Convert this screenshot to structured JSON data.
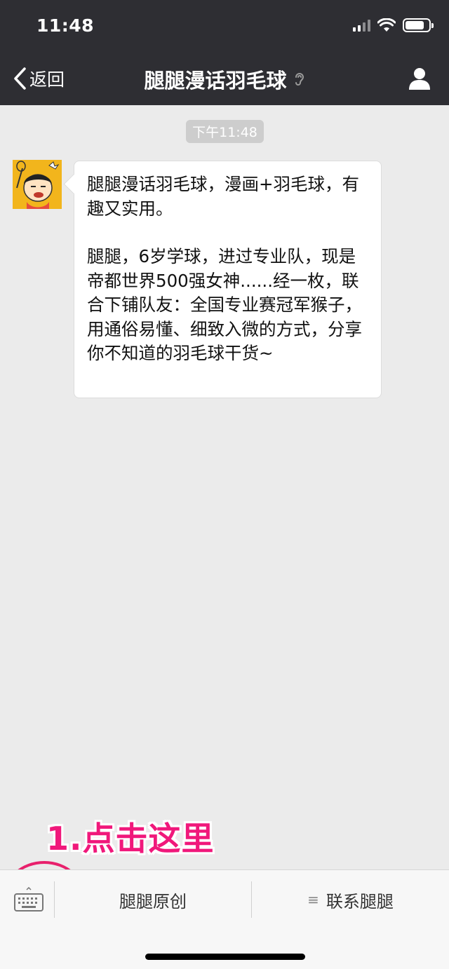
{
  "status_bar": {
    "time": "11:48",
    "battery_level": 0.8
  },
  "nav": {
    "back_label": "返回",
    "title": "腿腿漫话羽毛球"
  },
  "chat": {
    "timestamp": "下午11:48",
    "message": {
      "paragraph1": "腿腿漫话羽毛球，漫画+羽毛球，有趣又实用。",
      "paragraph2": "腿腿，6岁学球，进过专业队，现是帝都世界500强女神......经一枚，联合下铺队友：全国专业赛冠军猴子，用通俗易懂、细致入微的方式，分享你不知道的羽毛球干货~"
    }
  },
  "annotation": {
    "text": "1.点击这里"
  },
  "bottom_menu": {
    "items": [
      {
        "label": "腿腿原创"
      },
      {
        "label": "联系腿腿",
        "icon": "menu-lines-icon"
      }
    ]
  },
  "colors": {
    "nav_bg": "#2e2e33",
    "chat_bg": "#ebebeb",
    "annotation": "#f0187b"
  }
}
